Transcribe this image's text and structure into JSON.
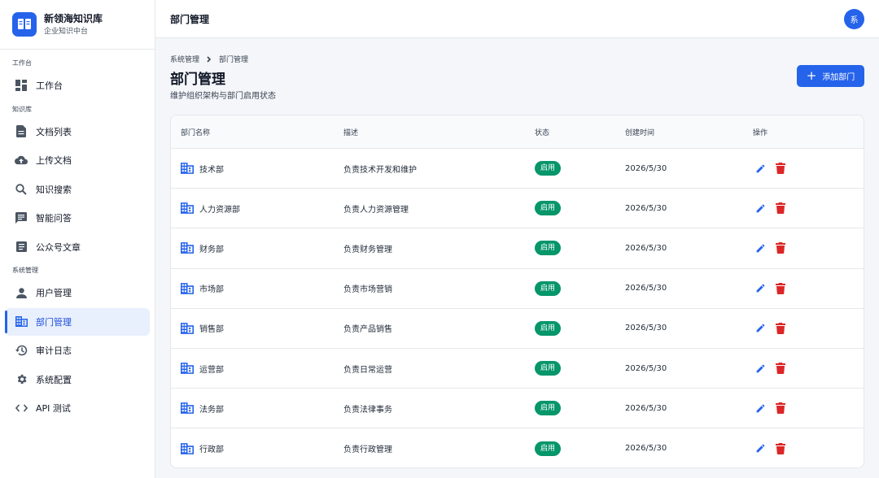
{
  "brand": {
    "name": "新领海知识库",
    "subtitle": "企业知识中台"
  },
  "sidebar": {
    "groups": [
      {
        "label": "工作台",
        "items": [
          {
            "label": "工作台",
            "icon": "dashboard-icon"
          }
        ]
      },
      {
        "label": "知识库",
        "items": [
          {
            "label": "文档列表",
            "icon": "document-icon"
          },
          {
            "label": "上传文档",
            "icon": "cloud-upload-icon"
          },
          {
            "label": "知识搜索",
            "icon": "search-icon"
          },
          {
            "label": "智能问答",
            "icon": "chat-icon"
          },
          {
            "label": "公众号文章",
            "icon": "article-icon"
          }
        ]
      },
      {
        "label": "系统管理",
        "items": [
          {
            "label": "用户管理",
            "icon": "person-icon"
          },
          {
            "label": "部门管理",
            "icon": "building-icon",
            "active": true
          },
          {
            "label": "审计日志",
            "icon": "history-icon"
          },
          {
            "label": "系统配置",
            "icon": "gear-icon"
          },
          {
            "label": "API 测试",
            "icon": "code-icon"
          }
        ]
      }
    ]
  },
  "topbar": {
    "title": "部门管理",
    "avatar": "系"
  },
  "breadcrumb": {
    "parent": "系统管理",
    "current": "部门管理"
  },
  "page": {
    "title": "部门管理",
    "subtitle": "维护组织架构与部门启用状态",
    "add_label": "添加部门"
  },
  "table": {
    "headers": {
      "name": "部门名称",
      "desc": "描述",
      "status": "状态",
      "time": "创建时间",
      "ops": "操作"
    },
    "rows": [
      {
        "name": "技术部",
        "desc": "负责技术开发和维护",
        "status": "启用",
        "time": "2026/5/30"
      },
      {
        "name": "人力资源部",
        "desc": "负责人力资源管理",
        "status": "启用",
        "time": "2026/5/30"
      },
      {
        "name": "财务部",
        "desc": "负责财务管理",
        "status": "启用",
        "time": "2026/5/30"
      },
      {
        "name": "市场部",
        "desc": "负责市场营销",
        "status": "启用",
        "time": "2026/5/30"
      },
      {
        "name": "销售部",
        "desc": "负责产品销售",
        "status": "启用",
        "time": "2026/5/30"
      },
      {
        "name": "运营部",
        "desc": "负责日常运营",
        "status": "启用",
        "time": "2026/5/30"
      },
      {
        "name": "法务部",
        "desc": "负责法律事务",
        "status": "启用",
        "time": "2026/5/30"
      },
      {
        "name": "行政部",
        "desc": "负责行政管理",
        "status": "启用",
        "time": "2026/5/30"
      }
    ]
  },
  "colors": {
    "primary": "#2563eb",
    "success": "#059669",
    "danger": "#dc2626",
    "active_bg": "#e8effd"
  }
}
